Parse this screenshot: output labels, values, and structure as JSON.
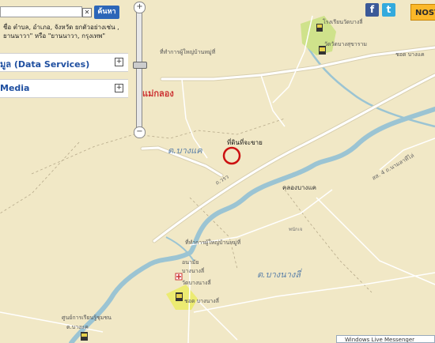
{
  "search": {
    "value": "",
    "clear_symbol": "✕",
    "button_label": "ค้นหา",
    "hint": "ชื่อ ตำบล, อำเภอ, จังหวัด ยกตัวอย่างเช่น , ยานนาวา\" หรือ \"ยานนาวา, กรุงเทพ\""
  },
  "panels": [
    {
      "label": "มูล (Data Services)",
      "toggle": "+"
    },
    {
      "label": "Media",
      "toggle": "+"
    }
  ],
  "zoom": {
    "plus": "+",
    "minus": "−",
    "level": 0.45
  },
  "header": {
    "facebook": "f",
    "twitter": "t",
    "brand": "NOST"
  },
  "marker": {
    "label": "ที่ดินที่จะขาย",
    "color": "#cc1111"
  },
  "place_labels": {
    "red_district": "แม่กลอง",
    "tambon_1": "ต.บางแค",
    "tambon_2": "ต.บางนางลี่",
    "canal": "คลองบางแค",
    "road_1": "ถ.วรว",
    "road_2": "สส. 4 ถ.นามลาทีไล่",
    "school_top_1": "โรงเรียนวัดบางลี่",
    "school_top_2": "วัดวัดบางสุขาราม",
    "office_top": "ชอด บางแค",
    "health_1": "ที่ทำการผู้ใหญ่บ้านหมู่ที่",
    "health_2": "ที่ทำการผู้ใหญ่บ้านหมู่ที่",
    "hospital_label": "อนามัย",
    "bottom_1": "บางนางลี่",
    "bottom_2": "วัดบางนางลี่",
    "bottom_3": "ชอด บางนางลี่",
    "community": "ศูนย์การเรียนรู้ชุมชน",
    "community_2": "ต.บางแค",
    "small_1": "พนักเจ"
  },
  "messenger": {
    "label": "Windows Live Messenger"
  },
  "colors": {
    "land": "#f1e8c6",
    "river": "#9bc4d3",
    "road": "#ffffff",
    "road_edge": "#d8cfb0",
    "park": "#cfe28b"
  }
}
